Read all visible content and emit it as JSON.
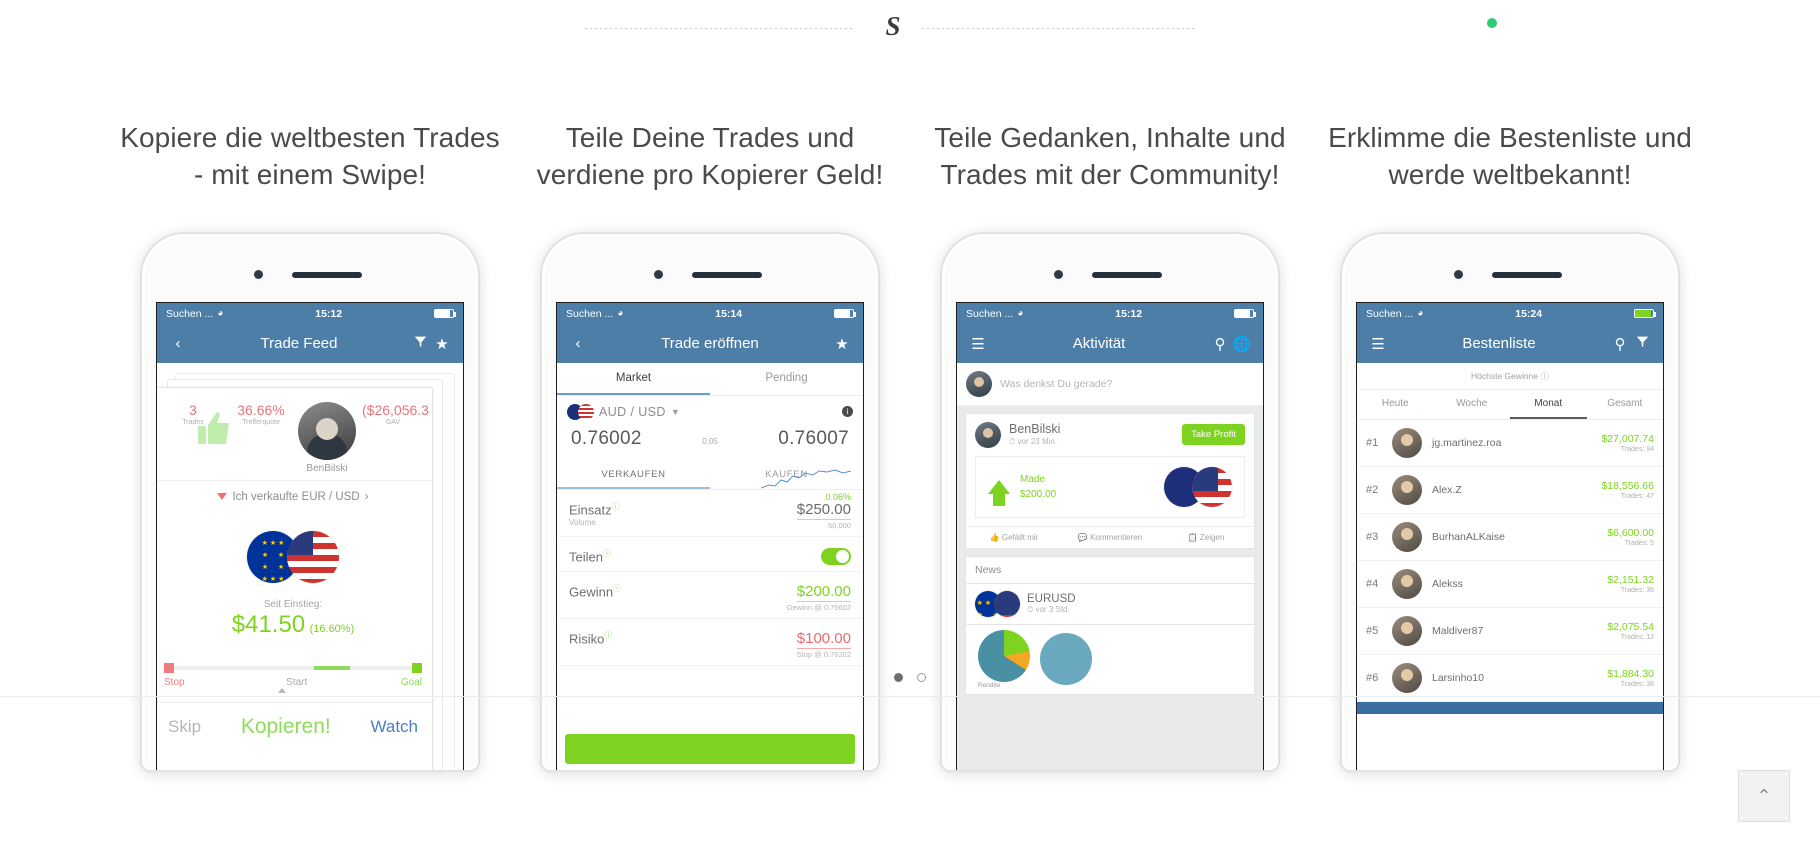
{
  "header": {
    "logo_glyph": "S",
    "status_dot_color": "#2ecc71"
  },
  "carousel": {
    "dots": [
      {
        "label": "slide-1",
        "active": true
      },
      {
        "label": "slide-2",
        "active": false
      }
    ]
  },
  "footer": {
    "scroll_top_glyph": "⌃"
  },
  "slides": [
    {
      "title": "Kopiere die weltbesten Trades - mit einem Swipe!",
      "phone": {
        "status": {
          "carrier": "Suchen ...",
          "wifi": "●",
          "time": "15:12"
        },
        "nav": {
          "back": "‹",
          "title": "Trade Feed",
          "icon1": "filter-icon",
          "icon2": "star-icon"
        },
        "stats": {
          "trades_value": "3",
          "trades_label": "Trades",
          "hitrate_value": "36.66%",
          "hitrate_label": "Trefferquote",
          "gav_value": "($26,056.3",
          "gav_label": "GAV"
        },
        "trader_name": "BenBilski",
        "sell_text": "Ich verkaufte EUR / USD",
        "pair_left": "EUR",
        "pair_right": "USD",
        "since_label": "Seit Einstieg:",
        "pnl_value": "$41.50",
        "pnl_pct": "(16.60%)",
        "slider": {
          "stop": "Stop",
          "start": "Start",
          "goal": "Goal"
        },
        "actions": {
          "skip": "Skip",
          "copy": "Kopieren!",
          "watch": "Watch"
        }
      }
    },
    {
      "title": "Teile Deine Trades und verdiene pro Kopierer Geld!",
      "phone": {
        "status": {
          "carrier": "Suchen ...",
          "wifi": "●",
          "time": "15:14"
        },
        "nav": {
          "back": "‹",
          "title": "Trade eröffnen",
          "icon1": "star-icon"
        },
        "tabs": [
          {
            "label": "Market",
            "active": true
          },
          {
            "label": "Pending",
            "active": false
          }
        ],
        "pair": "AUD / USD",
        "spark_pct": "0.06%",
        "bid": "0.76002",
        "spread": "0.05",
        "ask": "0.76007",
        "side_tabs": [
          {
            "label": "VERKAUFEN",
            "active": true
          },
          {
            "label": "KAUFEN",
            "active": false
          }
        ],
        "rows": [
          {
            "label": "Einsatz",
            "sub": "Volume",
            "value": "$250.00",
            "value_sub": "50,000",
            "value_color": "gray"
          },
          {
            "label": "Teilen",
            "sub": "",
            "toggle": true
          },
          {
            "label": "Gewinn",
            "sub": "",
            "value": "$200.00",
            "value_sub": "Gewinn @ 0.75602",
            "value_color": "green"
          },
          {
            "label": "Risiko",
            "sub": "",
            "value": "$100.00",
            "value_sub": "Stop @ 0.76202",
            "value_color": "red"
          }
        ]
      }
    },
    {
      "title": "Teile Gedanken, Inhalte und Trades mit der Community!",
      "phone": {
        "status": {
          "carrier": "Suchen ...",
          "wifi": "●",
          "time": "15:12"
        },
        "nav": {
          "menu": "☰",
          "title": "Aktivität",
          "icon1": "search-icon",
          "icon2": "globe-icon"
        },
        "composer_placeholder": "Was denkst Du gerade?",
        "post": {
          "author": "BenBilski",
          "time": "vor 23 Min.",
          "badge": "Take Profit",
          "made_label": "Made",
          "made_value": "$200.00",
          "pair_left": "AUD",
          "pair_right": "USD",
          "actions": [
            "Gefällt mir",
            "Kommentieren",
            "Zeigen"
          ]
        },
        "news_header": "News",
        "news_item": {
          "title": "EURUSD",
          "time": "vor 3 Std.",
          "chart_label": "Rendite"
        }
      }
    },
    {
      "title": "Erklimme die Bestenliste und werde weltbekannt!",
      "phone": {
        "status": {
          "carrier": "Suchen ...",
          "wifi": "●",
          "time": "15:24"
        },
        "nav": {
          "menu": "☰",
          "title": "Bestenliste",
          "icon1": "search-icon",
          "icon2": "filter-icon"
        },
        "subtitle": "Höchste Gewinne",
        "tabs": [
          {
            "label": "Heute",
            "active": false
          },
          {
            "label": "Woche",
            "active": false
          },
          {
            "label": "Monat",
            "active": true
          },
          {
            "label": "Gesamt",
            "active": false
          }
        ],
        "rows": [
          {
            "rank": "#1",
            "name": "jg.martinez.roa",
            "amount": "$27,007.74",
            "trades": "Trades: 94"
          },
          {
            "rank": "#2",
            "name": "Alex.Z",
            "amount": "$18,556.66",
            "trades": "Trades: 47"
          },
          {
            "rank": "#3",
            "name": "BurhanALKaise",
            "amount": "$6,600.00",
            "trades": "Trades: 5"
          },
          {
            "rank": "#4",
            "name": "Alekss",
            "amount": "$2,151.32",
            "trades": "Trades: 36"
          },
          {
            "rank": "#5",
            "name": "Maldiver87",
            "amount": "$2,075.54",
            "trades": "Trades: 12"
          },
          {
            "rank": "#6",
            "name": "Larsinho10",
            "amount": "$1,884.30",
            "trades": "Trades: 38"
          }
        ]
      }
    }
  ]
}
